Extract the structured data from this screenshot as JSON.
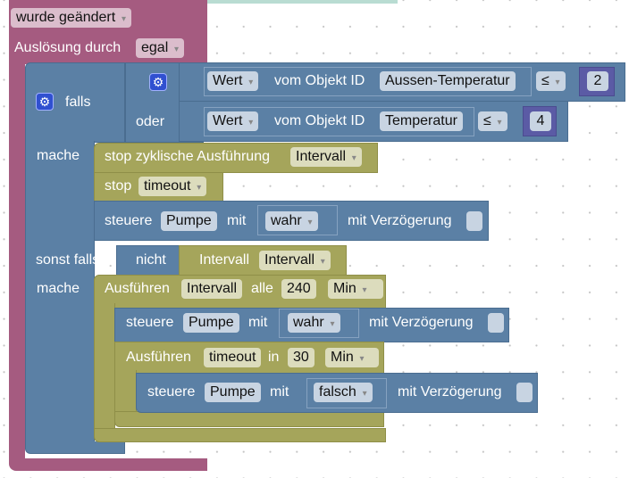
{
  "trigger": {
    "event_field": "wurde geändert",
    "label_trigger": "Auslösung durch",
    "trigger_field": "egal"
  },
  "if_block": {
    "label_if": "falls",
    "label_or": "oder",
    "label_do": "mache",
    "label_elseif": "sonst falls",
    "label_do2": "mache",
    "label_not": "nicht"
  },
  "cond1": {
    "attr": "Wert",
    "label": "vom Objekt ID",
    "object": "Aussen-Temperatur",
    "op": "≤",
    "value": "2"
  },
  "cond2": {
    "attr": "Wert",
    "label": "vom Objekt ID",
    "object": "Temperatur",
    "op": "≤",
    "value": "4"
  },
  "stop_interval": {
    "label": "stop zyklische Ausführung",
    "field": "Intervall"
  },
  "stop_timeout": {
    "label": "stop",
    "field": "timeout"
  },
  "set1": {
    "label": "steuere",
    "object": "Pumpe",
    "label_with": "mit",
    "value": "wahr",
    "label_delay": "mit Verzögerung"
  },
  "elseif_cond": {
    "label": "Intervall",
    "field": "Intervall"
  },
  "interval": {
    "label": "Ausführen",
    "name": "Intervall",
    "label_every": "alle",
    "value": "240",
    "unit": "Min"
  },
  "set2": {
    "label": "steuere",
    "object": "Pumpe",
    "label_with": "mit",
    "value": "wahr",
    "label_delay": "mit Verzögerung"
  },
  "timeout": {
    "label": "Ausführen",
    "name": "timeout",
    "label_in": "in",
    "value": "30",
    "unit": "Min"
  },
  "set3": {
    "label": "steuere",
    "object": "Pumpe",
    "label_with": "mit",
    "value": "falsch",
    "label_delay": "mit Verzögerung"
  },
  "colors": {
    "trigger": "#a55b80",
    "logic": "#5b80a5",
    "timer": "#a5a55b",
    "math": "#5b5ba5"
  }
}
